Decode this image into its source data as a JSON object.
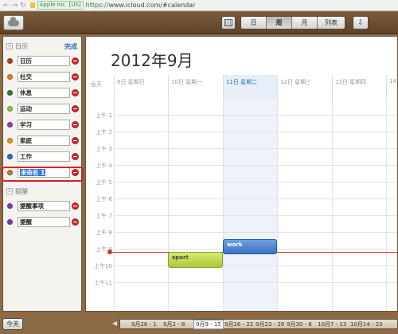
{
  "browser": {
    "cert_label": "Apple Inc. [US]",
    "url_scheme": "https://",
    "url_rest": "www.icloud.com/#calendar"
  },
  "toolbar": {
    "views": [
      "日",
      "周",
      "月",
      "列表"
    ],
    "active_view": "周"
  },
  "sidebar": {
    "calendars_heading": "日历",
    "done_label": "完成",
    "calendars": [
      {
        "label": "日历",
        "color": "#c0392b"
      },
      {
        "label": "社交",
        "color": "#e67e22"
      },
      {
        "label": "休息",
        "color": "#2e7d32"
      },
      {
        "label": "运动",
        "color": "#8bc34a"
      },
      {
        "label": "学习",
        "color": "#8e44ad"
      },
      {
        "label": "家庭",
        "color": "#d4a017"
      },
      {
        "label": "工作",
        "color": "#2a6fc4"
      },
      {
        "label": "未命名 1",
        "color": "#b37a4c"
      }
    ],
    "reminders_heading": "提醒",
    "reminders": [
      {
        "label": "提醒事项",
        "color": "#7a3fa0"
      },
      {
        "label": "提醒",
        "color": "#7a3fa0"
      }
    ]
  },
  "main": {
    "month_title": "2012年9月",
    "allday_label": "全天",
    "days": [
      {
        "label": "9日 星期日",
        "today": false
      },
      {
        "label": "10日 星期一",
        "today": false
      },
      {
        "label": "11日 星期二",
        "today": true
      },
      {
        "label": "12日 星期三",
        "today": false
      },
      {
        "label": "13日 星期四",
        "today": false
      },
      {
        "label": "14",
        "today": false
      }
    ],
    "hours": [
      "上午 1",
      "上午 2",
      "上午 3",
      "上午 4",
      "上午 5",
      "上午 6",
      "上午 7",
      "上午 8",
      "上午 9",
      "上午10",
      "上午11"
    ],
    "events": [
      {
        "title": "work",
        "day": "11日 星期二"
      },
      {
        "title": "sport",
        "day": "10日 星期一"
      }
    ]
  },
  "footer": {
    "today_label": "今天",
    "weeks": [
      "9月26 - 1",
      "9月2 - 8",
      "9月9 - 15",
      "9月16 - 22",
      "9月23 - 29",
      "9月30 - 6",
      "10月7 - 13",
      "10月14 - 20"
    ],
    "current_week": "9月9 - 15"
  }
}
